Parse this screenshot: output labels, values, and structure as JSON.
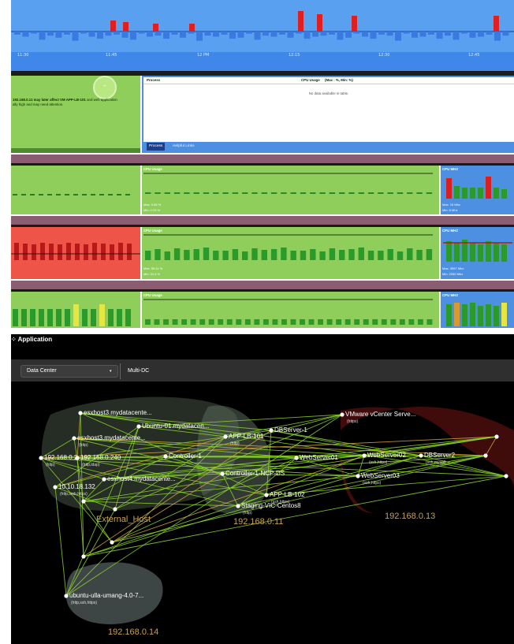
{
  "timeline": {
    "tick_labels": [
      "11:30",
      "11:45",
      "12 PM",
      "12:15",
      "12:30",
      "12:45"
    ],
    "colors": {
      "background": "#5aa0f0",
      "bar_up": "#e02020",
      "bar_down": "#3a7ae0"
    }
  },
  "alert": {
    "badge": "!!!",
    "message_pre": "192.168.0.11 may later affect VM ",
    "message_vm": "APP-LB-101",
    "message_post": " and web application",
    "message_line2": "ally high and may need attention."
  },
  "process_table": {
    "col_process": "Process",
    "col_cpu": "CPU Usage",
    "col_range": "(Max : %, Min: %)",
    "empty_text": "No data available in table.",
    "tabs": [
      "Process",
      "Helpful Links"
    ]
  },
  "rows": [
    {
      "state": "ok",
      "cpu_title": "CPU Usage",
      "max_text": "Max: 0.84 %",
      "min_text": "Min: 0.33 %",
      "mhz_title": "CPU MHZ",
      "mhz_max_text": "Max: 16 Mhz",
      "mhz_min_text": "Min: 8 Mhz"
    },
    {
      "state": "critical",
      "cpu_title": "CPU Usage",
      "max_text": "Max: 55.11 %",
      "min_text": "Min: 31.4 %",
      "mhz_title": "CPU MHZ",
      "mhz_max_text": "Max: 3967 Mhz",
      "mhz_min_text": "Min: 2260 Mhz"
    },
    {
      "state": "ok",
      "cpu_title": "CPU Usage",
      "mhz_title": "CPU MHZ"
    }
  ],
  "application": {
    "title": "Application",
    "filter_label": "Data Center",
    "filter_value": "Multi-DC",
    "groups": [
      "External_Host",
      "192.168.0.11",
      "192.168.0.13",
      "192.168.0.14"
    ],
    "nodes": [
      {
        "label": "esxhost3.mydatacente...",
        "sub": ""
      },
      {
        "label": "esxhost3.mydatacente...",
        "sub": "(http)"
      },
      {
        "label": "Ubuntu-01.mydatacen...",
        "sub": ""
      },
      {
        "label": "192.168.0.2",
        "sub": "(http)"
      },
      {
        "label": "192.168.0.240",
        "sub": "(http,ldap)"
      },
      {
        "label": "Controller-1",
        "sub": ""
      },
      {
        "label": "APP-LB-101",
        "sub": "(http)"
      },
      {
        "label": "WebServer01",
        "sub": ""
      },
      {
        "label": "DBServer-1",
        "sub": ""
      },
      {
        "label": "esxhost4.mydatacente...",
        "sub": ""
      },
      {
        "label": "10.10.18.132",
        "sub": "(http,smb,https)"
      },
      {
        "label": "Controller-1-NCP-DS",
        "sub": ""
      },
      {
        "label": "APP-LB-102",
        "sub": "(ssh,https)"
      },
      {
        "label": "Staging-VIC-Centos8",
        "sub": "(http)"
      },
      {
        "label": "VMware vCenter Serve...",
        "sub": "(https)"
      },
      {
        "label": "WebServer02",
        "sub": "(ssh,https)"
      },
      {
        "label": "DBServer2",
        "sub": "(ssh,mysql)"
      },
      {
        "label": "WebServer03",
        "sub": "(ssh,https)"
      },
      {
        "label": "ubuntu-ulla-umang-4.0-7...",
        "sub": "(http,ssh,https)"
      }
    ],
    "colors": {
      "edge": "#8ed62a",
      "edge_alt": "#d9a63a",
      "group_label": "#c8a24a"
    }
  }
}
